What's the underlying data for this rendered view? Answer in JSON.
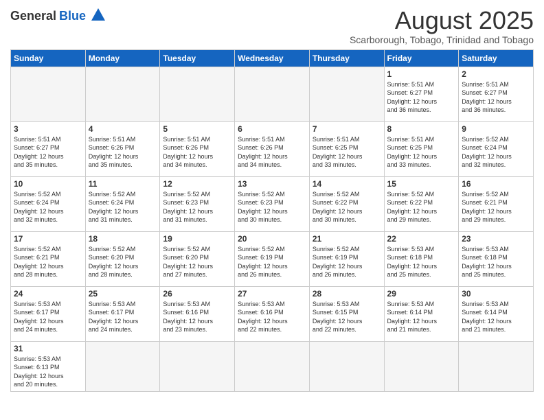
{
  "header": {
    "logo_general": "General",
    "logo_blue": "Blue",
    "month_title": "August 2025",
    "subtitle": "Scarborough, Tobago, Trinidad and Tobago"
  },
  "days_of_week": [
    "Sunday",
    "Monday",
    "Tuesday",
    "Wednesday",
    "Thursday",
    "Friday",
    "Saturday"
  ],
  "weeks": [
    [
      {
        "day": "",
        "info": ""
      },
      {
        "day": "",
        "info": ""
      },
      {
        "day": "",
        "info": ""
      },
      {
        "day": "",
        "info": ""
      },
      {
        "day": "",
        "info": ""
      },
      {
        "day": "1",
        "info": "Sunrise: 5:51 AM\nSunset: 6:27 PM\nDaylight: 12 hours\nand 36 minutes."
      },
      {
        "day": "2",
        "info": "Sunrise: 5:51 AM\nSunset: 6:27 PM\nDaylight: 12 hours\nand 36 minutes."
      }
    ],
    [
      {
        "day": "3",
        "info": "Sunrise: 5:51 AM\nSunset: 6:27 PM\nDaylight: 12 hours\nand 35 minutes."
      },
      {
        "day": "4",
        "info": "Sunrise: 5:51 AM\nSunset: 6:26 PM\nDaylight: 12 hours\nand 35 minutes."
      },
      {
        "day": "5",
        "info": "Sunrise: 5:51 AM\nSunset: 6:26 PM\nDaylight: 12 hours\nand 34 minutes."
      },
      {
        "day": "6",
        "info": "Sunrise: 5:51 AM\nSunset: 6:26 PM\nDaylight: 12 hours\nand 34 minutes."
      },
      {
        "day": "7",
        "info": "Sunrise: 5:51 AM\nSunset: 6:25 PM\nDaylight: 12 hours\nand 33 minutes."
      },
      {
        "day": "8",
        "info": "Sunrise: 5:51 AM\nSunset: 6:25 PM\nDaylight: 12 hours\nand 33 minutes."
      },
      {
        "day": "9",
        "info": "Sunrise: 5:52 AM\nSunset: 6:24 PM\nDaylight: 12 hours\nand 32 minutes."
      }
    ],
    [
      {
        "day": "10",
        "info": "Sunrise: 5:52 AM\nSunset: 6:24 PM\nDaylight: 12 hours\nand 32 minutes."
      },
      {
        "day": "11",
        "info": "Sunrise: 5:52 AM\nSunset: 6:24 PM\nDaylight: 12 hours\nand 31 minutes."
      },
      {
        "day": "12",
        "info": "Sunrise: 5:52 AM\nSunset: 6:23 PM\nDaylight: 12 hours\nand 31 minutes."
      },
      {
        "day": "13",
        "info": "Sunrise: 5:52 AM\nSunset: 6:23 PM\nDaylight: 12 hours\nand 30 minutes."
      },
      {
        "day": "14",
        "info": "Sunrise: 5:52 AM\nSunset: 6:22 PM\nDaylight: 12 hours\nand 30 minutes."
      },
      {
        "day": "15",
        "info": "Sunrise: 5:52 AM\nSunset: 6:22 PM\nDaylight: 12 hours\nand 29 minutes."
      },
      {
        "day": "16",
        "info": "Sunrise: 5:52 AM\nSunset: 6:21 PM\nDaylight: 12 hours\nand 29 minutes."
      }
    ],
    [
      {
        "day": "17",
        "info": "Sunrise: 5:52 AM\nSunset: 6:21 PM\nDaylight: 12 hours\nand 28 minutes."
      },
      {
        "day": "18",
        "info": "Sunrise: 5:52 AM\nSunset: 6:20 PM\nDaylight: 12 hours\nand 28 minutes."
      },
      {
        "day": "19",
        "info": "Sunrise: 5:52 AM\nSunset: 6:20 PM\nDaylight: 12 hours\nand 27 minutes."
      },
      {
        "day": "20",
        "info": "Sunrise: 5:52 AM\nSunset: 6:19 PM\nDaylight: 12 hours\nand 26 minutes."
      },
      {
        "day": "21",
        "info": "Sunrise: 5:52 AM\nSunset: 6:19 PM\nDaylight: 12 hours\nand 26 minutes."
      },
      {
        "day": "22",
        "info": "Sunrise: 5:53 AM\nSunset: 6:18 PM\nDaylight: 12 hours\nand 25 minutes."
      },
      {
        "day": "23",
        "info": "Sunrise: 5:53 AM\nSunset: 6:18 PM\nDaylight: 12 hours\nand 25 minutes."
      }
    ],
    [
      {
        "day": "24",
        "info": "Sunrise: 5:53 AM\nSunset: 6:17 PM\nDaylight: 12 hours\nand 24 minutes."
      },
      {
        "day": "25",
        "info": "Sunrise: 5:53 AM\nSunset: 6:17 PM\nDaylight: 12 hours\nand 24 minutes."
      },
      {
        "day": "26",
        "info": "Sunrise: 5:53 AM\nSunset: 6:16 PM\nDaylight: 12 hours\nand 23 minutes."
      },
      {
        "day": "27",
        "info": "Sunrise: 5:53 AM\nSunset: 6:16 PM\nDaylight: 12 hours\nand 22 minutes."
      },
      {
        "day": "28",
        "info": "Sunrise: 5:53 AM\nSunset: 6:15 PM\nDaylight: 12 hours\nand 22 minutes."
      },
      {
        "day": "29",
        "info": "Sunrise: 5:53 AM\nSunset: 6:14 PM\nDaylight: 12 hours\nand 21 minutes."
      },
      {
        "day": "30",
        "info": "Sunrise: 5:53 AM\nSunset: 6:14 PM\nDaylight: 12 hours\nand 21 minutes."
      }
    ],
    [
      {
        "day": "31",
        "info": "Sunrise: 5:53 AM\nSunset: 6:13 PM\nDaylight: 12 hours\nand 20 minutes."
      },
      {
        "day": "",
        "info": ""
      },
      {
        "day": "",
        "info": ""
      },
      {
        "day": "",
        "info": ""
      },
      {
        "day": "",
        "info": ""
      },
      {
        "day": "",
        "info": ""
      },
      {
        "day": "",
        "info": ""
      }
    ]
  ]
}
